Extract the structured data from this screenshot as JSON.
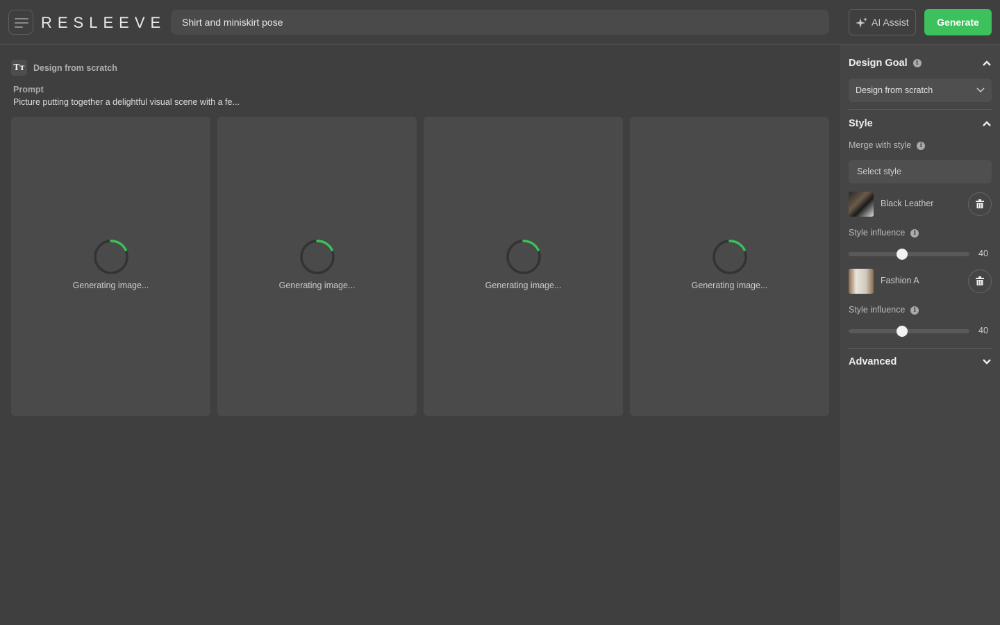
{
  "header": {
    "logo": "RESLEEVE",
    "search_value": "Shirt and miniskirt pose",
    "ai_assist_label": "AI Assist",
    "generate_label": "Generate",
    "accent": "#3cc15c"
  },
  "main": {
    "goal_label": "Design from scratch",
    "goal_icon": "text-icon",
    "prompt_label": "Prompt",
    "prompt_text": "Picture putting together a delightful visual scene with a fe...",
    "cards": [
      {
        "status": "Generating image..."
      },
      {
        "status": "Generating image..."
      },
      {
        "status": "Generating image..."
      },
      {
        "status": "Generating image..."
      }
    ]
  },
  "sidebar": {
    "design_goal": {
      "title": "Design Goal",
      "selected": "Design from scratch"
    },
    "style": {
      "title": "Style",
      "merge_label": "Merge with style",
      "select_placeholder": "Select style",
      "items": [
        {
          "name": "Black Leather",
          "influence_label": "Style influence",
          "influence": 40
        },
        {
          "name": "Fashion A",
          "influence_label": "Style influence",
          "influence": 40
        }
      ]
    },
    "advanced": {
      "title": "Advanced"
    }
  }
}
